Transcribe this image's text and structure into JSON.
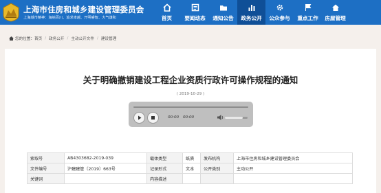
{
  "header": {
    "title": "上海市住房和城乡建设管理委员会",
    "subtitle": "上海城市精神：海纳百川、追求卓越、开明睿智、大气谦和",
    "nav": [
      {
        "label": "首页",
        "icon": "home-icon"
      },
      {
        "label": "要闻动态",
        "icon": "news-icon"
      },
      {
        "label": "通知公告",
        "icon": "folder-icon"
      },
      {
        "label": "政务公开",
        "icon": "chart-icon",
        "active": true
      },
      {
        "label": "公众参与",
        "icon": "gear-icon"
      },
      {
        "label": "重点工作",
        "icon": "flag-icon"
      },
      {
        "label": "房屋管理",
        "icon": "house-icon"
      }
    ]
  },
  "breadcrumb": {
    "prefix": "您的位置：",
    "items": [
      "首页",
      "政务公开",
      "主动公开文件",
      "建设管理"
    ]
  },
  "article": {
    "title": "关于明确撤销建设工程企业资质行政许可操作规程的通知",
    "date": "( 2019-10-29 )"
  },
  "player": {
    "current_time": "00:00",
    "duration": "00:00",
    "volume": 0.8
  },
  "info_table": {
    "rows": [
      [
        "索取号",
        "AB4303682-2019-039",
        "载体类型",
        "纸质",
        "发布机构",
        "上海市住房和城乡建设管理委员会"
      ],
      [
        "文件编号",
        "沪建建管〔2019〕663号",
        "记录形式",
        "文本",
        "公开类别",
        "主动公开"
      ],
      [
        "关键词",
        "",
        "内容描述",
        "",
        "",
        ""
      ]
    ]
  },
  "colors": {
    "header_bg": "#1d6fc4",
    "nav_active_bg": "#0f4f97",
    "page_bg": "#f5f0ec"
  }
}
